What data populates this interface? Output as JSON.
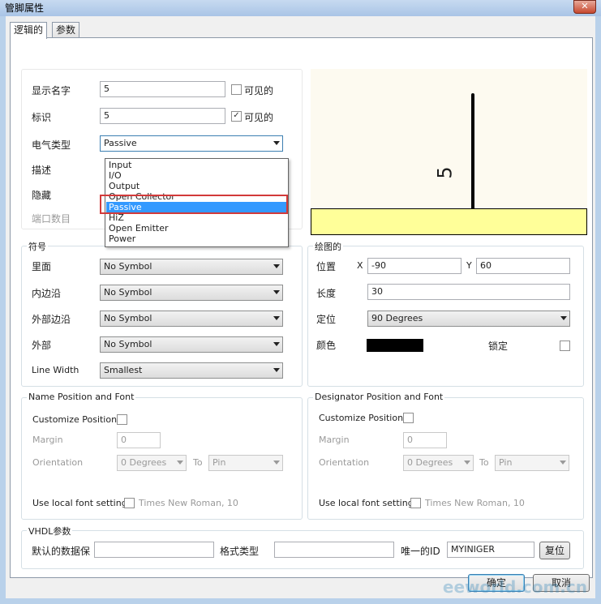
{
  "window": {
    "title": "管脚属性",
    "close_glyph": "✕"
  },
  "tabs": [
    {
      "label": "逻辑的"
    },
    {
      "label": "参数"
    }
  ],
  "logical": {
    "display_name": {
      "label": "显示名字",
      "value": "5",
      "visible_label": "可见的",
      "visible_checked": false
    },
    "designator": {
      "label": "标识",
      "value": "5",
      "visible_label": "可见的",
      "visible_checked": true
    },
    "electrical_type": {
      "label": "电气类型",
      "value": "Passive"
    },
    "description": {
      "label": "描述"
    },
    "hidden": {
      "label": "隐藏"
    },
    "port_number": {
      "label": "端口数目"
    },
    "dropdown_options": [
      "Input",
      "I/O",
      "Output",
      "Open Collector",
      "Passive",
      "HiZ",
      "Open Emitter",
      "Power"
    ],
    "dropdown_selected": "Passive"
  },
  "preview": {
    "pin_label": "5"
  },
  "symbol": {
    "title": "符号",
    "inside": {
      "label": "里面",
      "value": "No Symbol"
    },
    "inside_edge": {
      "label": "内边沿",
      "value": "No Symbol"
    },
    "outside_edge": {
      "label": "外部边沿",
      "value": "No Symbol"
    },
    "outside": {
      "label": "外部",
      "value": "No Symbol"
    },
    "line_width": {
      "label": "Line Width",
      "value": "Smallest"
    }
  },
  "graphical": {
    "title": "绘图的",
    "location": {
      "label": "位置",
      "x_label": "X",
      "x_value": "-90",
      "y_label": "Y",
      "y_value": "60"
    },
    "length": {
      "label": "长度",
      "value": "30"
    },
    "orientation": {
      "label": "定位",
      "value": "90 Degrees"
    },
    "color": {
      "label": "颜色",
      "value": "#000000"
    },
    "locked": {
      "label": "锁定",
      "checked": false
    }
  },
  "name_position": {
    "title": "Name Position and Font",
    "customize_label": "Customize Position",
    "margin_label": "Margin",
    "margin_value": "0",
    "orientation_label": "Orientation",
    "orientation_value": "0 Degrees",
    "to_label": "To",
    "to_value": "Pin",
    "font_label": "Use local font setting",
    "font_value": "Times New Roman, 10"
  },
  "designator_position": {
    "title": "Designator Position and Font",
    "customize_label": "Customize Position",
    "margin_label": "Margin",
    "margin_value": "0",
    "orientation_label": "Orientation",
    "orientation_value": "0 Degrees",
    "to_label": "To",
    "to_value": "Pin",
    "font_label": "Use local font setting",
    "font_value": "Times New Roman, 10"
  },
  "vhdl": {
    "title": "VHDL参数",
    "default_label": "默认的数据保",
    "default_value": "",
    "format_label": "格式类型",
    "format_value": "",
    "uid_label": "唯一的ID",
    "uid_value": "MYINIGER",
    "reset_label": "复位"
  },
  "buttons": {
    "ok": "确定",
    "cancel": "取消"
  },
  "watermark": "eeworld.com.cn"
}
